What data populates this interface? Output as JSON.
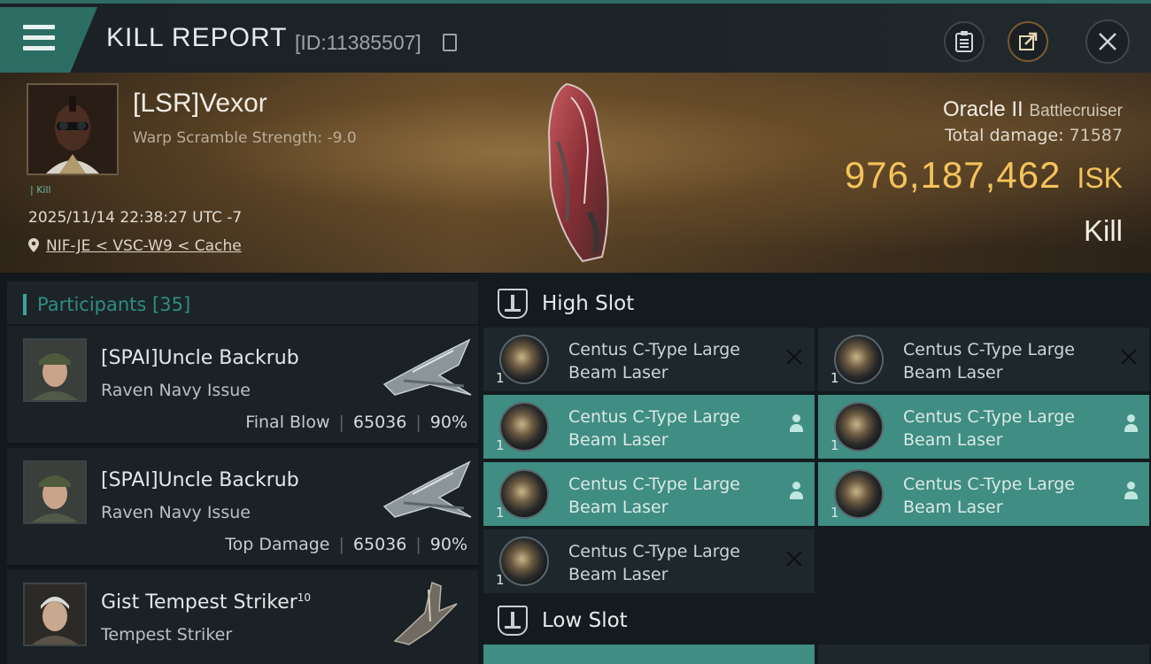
{
  "header": {
    "title": "KILL REPORT",
    "report_id": "[ID:11385507]",
    "icons": [
      "menu-icon",
      "copy-icon",
      "clipboard-icon",
      "share-icon",
      "close-icon"
    ]
  },
  "victim": {
    "name": "[LSR]Vexor",
    "warp_scramble": "Warp Scramble Strength: -9.0",
    "corp_tag": "| Kill",
    "datetime": "2025/11/14 22:38:27 UTC -7",
    "location": "NIF-JE < VSC-W9 < Cache",
    "ship_name": "Oracle II",
    "ship_class": "Battlecruiser",
    "total_damage_label": "Total damage:",
    "total_damage": "71587",
    "isk_value": "976,187,462",
    "isk_unit": "ISK",
    "result": "Kill"
  },
  "participants": {
    "header": "Participants [35]",
    "items": [
      {
        "name": "[SPAI]Uncle Backrub",
        "ship": "Raven Navy Issue",
        "label": "Final Blow",
        "damage": "65036",
        "percent": "90%"
      },
      {
        "name": "[SPAI]Uncle Backrub",
        "ship": "Raven Navy Issue",
        "label": "Top Damage",
        "damage": "65036",
        "percent": "90%"
      },
      {
        "name": "Gist Tempest Striker",
        "name_sup": "10",
        "ship": "Tempest Striker"
      }
    ]
  },
  "fitting": {
    "high_slot_label": "High Slot",
    "low_slot_label": "Low Slot",
    "high_slot_modules": [
      {
        "name": "Centus C-Type Large Beam Laser",
        "qty": "1",
        "state": "destroyed",
        "active": false
      },
      {
        "name": "Centus C-Type Large Beam Laser",
        "qty": "1",
        "state": "destroyed",
        "active": false
      },
      {
        "name": "Centus C-Type Large Beam Laser",
        "qty": "1",
        "state": "dropped",
        "active": true
      },
      {
        "name": "Centus C-Type Large Beam Laser",
        "qty": "1",
        "state": "dropped",
        "active": true
      },
      {
        "name": "Centus C-Type Large Beam Laser",
        "qty": "1",
        "state": "dropped",
        "active": true
      },
      {
        "name": "Centus C-Type Large Beam Laser",
        "qty": "1",
        "state": "dropped",
        "active": true
      },
      {
        "name": "Centus C-Type Large Beam Laser",
        "qty": "1",
        "state": "destroyed",
        "active": false
      }
    ]
  },
  "colors": {
    "accent": "#3f8d83",
    "isk": "#f4c35a",
    "panel": "#1e272b"
  }
}
